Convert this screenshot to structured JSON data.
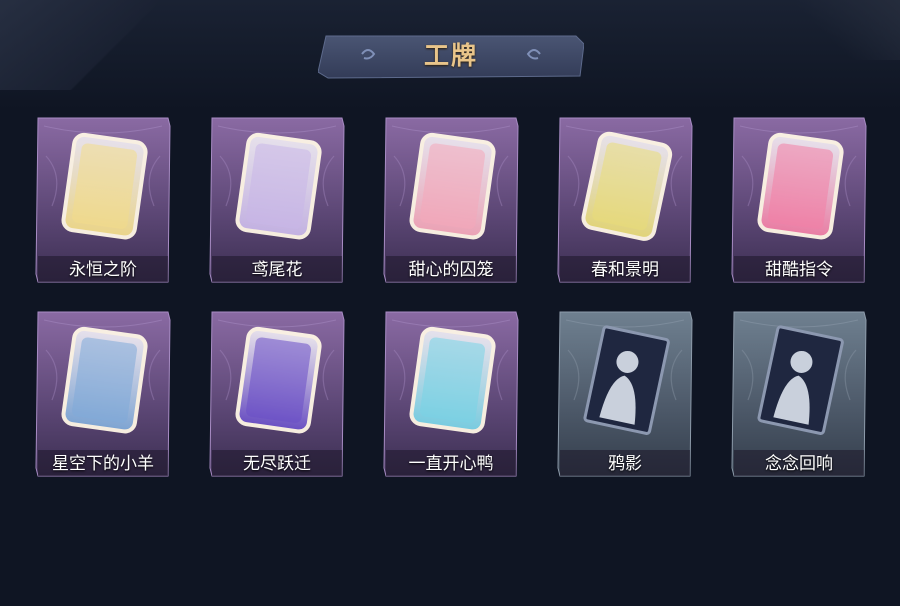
{
  "page": {
    "title": "工牌"
  },
  "badges": [
    {
      "name": "永恒之阶",
      "theme": "purple",
      "art": "golden-card-icon",
      "accent": "#f3dd8a"
    },
    {
      "name": "鸢尾花",
      "theme": "purple",
      "art": "lavender-card-icon",
      "accent": "#c9b7e8"
    },
    {
      "name": "甜心的囚笼",
      "theme": "purple",
      "art": "pink-sunset-card-icon",
      "accent": "#f4a7b9"
    },
    {
      "name": "春和景明",
      "theme": "purple",
      "art": "yellow-ornate-card-icon",
      "accent": "#e9dc78"
    },
    {
      "name": "甜酷指令",
      "theme": "purple",
      "art": "pink-shark-card-icon",
      "accent": "#f27fa6"
    },
    {
      "name": "星空下的小羊",
      "theme": "purple",
      "art": "night-sky-card-icon",
      "accent": "#7fa9d8"
    },
    {
      "name": "无尽跃迁",
      "theme": "purple",
      "art": "galaxy-card-icon",
      "accent": "#6a4fc7"
    },
    {
      "name": "一直开心鸭",
      "theme": "purple",
      "art": "duck-ocean-card-icon",
      "accent": "#79d3e6"
    },
    {
      "name": "鸦影",
      "theme": "gray",
      "art": "silhouette-card-icon",
      "accent": "#5a6378"
    },
    {
      "name": "念念回响",
      "theme": "gray",
      "art": "embrace-silhouette-card-icon",
      "accent": "#5a6378"
    }
  ]
}
